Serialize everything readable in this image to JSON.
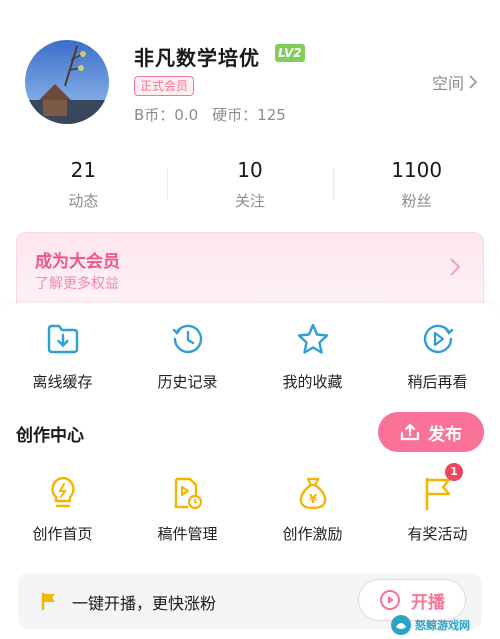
{
  "profile": {
    "name": "非凡数学培优",
    "level": "LV2",
    "vip_badge": "正式会员",
    "b_coin": "B币：0.0",
    "hard_coin": "硬币：125",
    "space_label": "空间"
  },
  "stats": [
    {
      "value": "21",
      "label": "动态"
    },
    {
      "value": "10",
      "label": "关注"
    },
    {
      "value": "1100",
      "label": "粉丝"
    }
  ],
  "vip_card": {
    "title": "成为大会员",
    "subtitle": "了解更多权益"
  },
  "quick_actions": [
    {
      "label": "离线缓存",
      "icon": "download-folder-icon"
    },
    {
      "label": "历史记录",
      "icon": "history-clock-icon"
    },
    {
      "label": "我的收藏",
      "icon": "star-icon"
    },
    {
      "label": "稍后再看",
      "icon": "watch-later-icon"
    }
  ],
  "creation": {
    "title": "创作中心",
    "publish_label": "发布",
    "items": [
      {
        "label": "创作首页",
        "icon": "bulb-icon"
      },
      {
        "label": "稿件管理",
        "icon": "manuscript-icon"
      },
      {
        "label": "创作激励",
        "icon": "money-bag-icon"
      },
      {
        "label": "有奖活动",
        "icon": "flag-icon",
        "badge": "1"
      }
    ]
  },
  "live": {
    "text": "一键开播，更快涨粉",
    "button_label": "开播"
  },
  "watermark": {
    "text": "怒鲸游戏网"
  },
  "colors": {
    "accent_pink": "#fb7299",
    "icon_blue": "#2f9fd8",
    "icon_yellow": "#f4b400",
    "level_green": "#7fcd5a",
    "badge_red": "#f0455f"
  }
}
